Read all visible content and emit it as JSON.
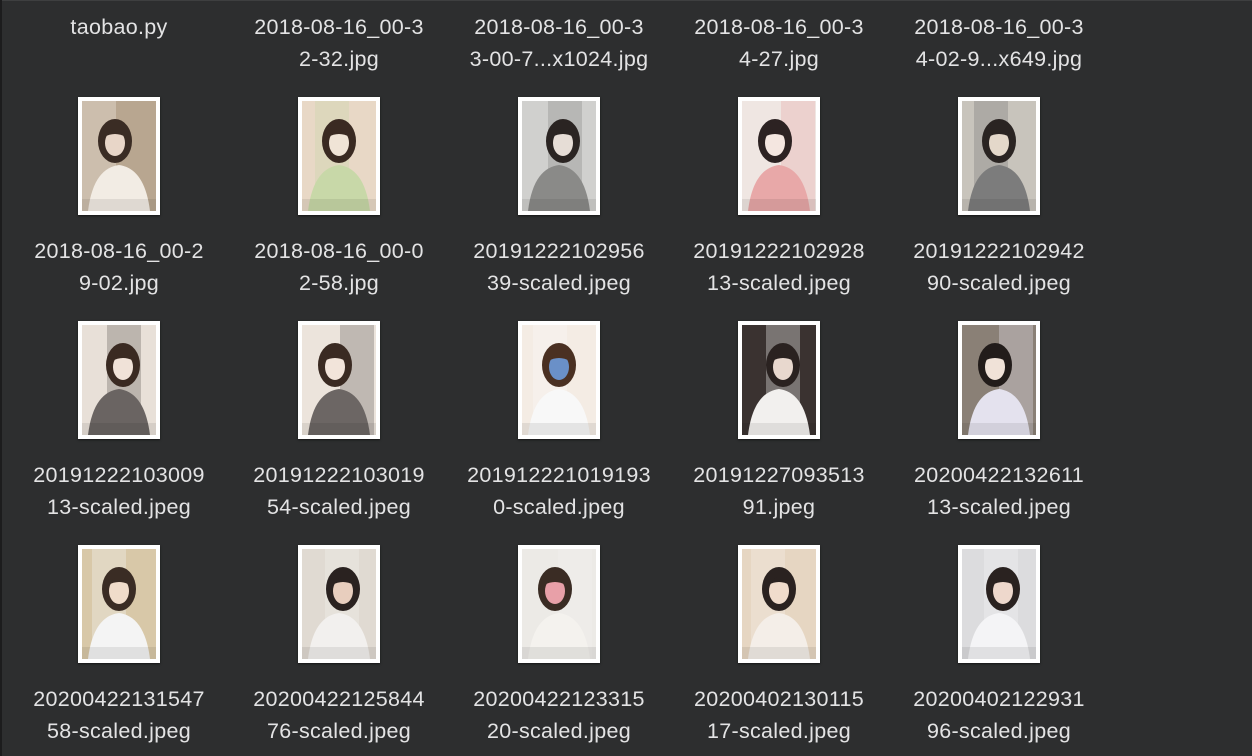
{
  "file_grid": {
    "rows": [
      {
        "items": [
          {
            "line1": "taobao.py",
            "line2": "",
            "has_thumb": false
          },
          {
            "line1": "2018-08-16_00-3",
            "line2": "2-32.jpg",
            "has_thumb": false
          },
          {
            "line1": "2018-08-16_00-3",
            "line2": "3-00-7...x1024.jpg",
            "has_thumb": false
          },
          {
            "line1": "2018-08-16_00-3",
            "line2": "4-27.jpg",
            "has_thumb": false
          },
          {
            "line1": "2018-08-16_00-3",
            "line2": "4-02-9...x649.jpg",
            "has_thumb": false
          }
        ]
      },
      {
        "items": [
          {
            "line1": "2018-08-16_00-2",
            "line2": "9-02.jpg",
            "has_thumb": true,
            "palette": [
              "#b8a690",
              "#f2ece4",
              "#3a2c24",
              "#e8d6c8"
            ]
          },
          {
            "line1": "2018-08-16_00-0",
            "line2": "2-58.jpg",
            "has_thumb": true,
            "palette": [
              "#e8d8c6",
              "#c8d8a8",
              "#3a2a22",
              "#f0e4d6"
            ]
          },
          {
            "line1": "20191222102956",
            "line2": "39-scaled.jpeg",
            "has_thumb": true,
            "palette": [
              "#d0d0ce",
              "#8a8a88",
              "#2a2422",
              "#e6ddd6"
            ]
          },
          {
            "line1": "20191222102928",
            "line2": "13-scaled.jpeg",
            "has_thumb": true,
            "palette": [
              "#efe6e2",
              "#e8a8a8",
              "#2c2222",
              "#f4e6e0"
            ]
          },
          {
            "line1": "20191222102942",
            "line2": "90-scaled.jpeg",
            "has_thumb": true,
            "palette": [
              "#c8c4bc",
              "#7c7c7c",
              "#2a2422",
              "#e4d8ca"
            ]
          }
        ]
      },
      {
        "items": [
          {
            "line1": "20191222103009",
            "line2": "13-scaled.jpeg",
            "has_thumb": true,
            "palette": [
              "#e8e0d8",
              "#6a6462",
              "#3a2a22",
              "#f0e2d8"
            ]
          },
          {
            "line1": "20191222103019",
            "line2": "54-scaled.jpeg",
            "has_thumb": true,
            "palette": [
              "#ece4dc",
              "#6c6664",
              "#3a2a22",
              "#f2e4da"
            ]
          },
          {
            "line1": "201912221019193",
            "line2": "0-scaled.jpeg",
            "has_thumb": true,
            "palette": [
              "#f4ece4",
              "#f8f8f8",
              "#4a3022",
              "#6a90c8"
            ]
          },
          {
            "line1": "20191227093513",
            "line2": "91.jpeg",
            "has_thumb": true,
            "palette": [
              "#3a3230",
              "#f2f0ee",
              "#2a2220",
              "#e8d8ce"
            ]
          },
          {
            "line1": "20200422132611",
            "line2": "13-scaled.jpeg",
            "has_thumb": true,
            "palette": [
              "#8a8076",
              "#e4e2ee",
              "#221c1a",
              "#f0e2d8"
            ]
          }
        ]
      },
      {
        "items": [
          {
            "line1": "20200422131547",
            "line2": "58-scaled.jpeg",
            "has_thumb": true,
            "palette": [
              "#d8c8a8",
              "#f4f4f4",
              "#3a2c24",
              "#f0dcca"
            ]
          },
          {
            "line1": "20200422125844",
            "line2": "76-scaled.jpeg",
            "has_thumb": true,
            "palette": [
              "#e0dad2",
              "#f2f0ee",
              "#2a2220",
              "#e8cebe"
            ]
          },
          {
            "line1": "20200422123315",
            "line2": "20-scaled.jpeg",
            "has_thumb": true,
            "palette": [
              "#eceae6",
              "#f4f2ee",
              "#3a2c24",
              "#e8a0a8"
            ]
          },
          {
            "line1": "20200402130115",
            "line2": "17-scaled.jpeg",
            "has_thumb": true,
            "palette": [
              "#e6d6c2",
              "#f4eee8",
              "#2a2220",
              "#f0dccc"
            ]
          },
          {
            "line1": "20200402122931",
            "line2": "96-scaled.jpeg",
            "has_thumb": true,
            "palette": [
              "#dcdcde",
              "#f4f4f6",
              "#2a2220",
              "#eed8cc"
            ]
          }
        ]
      }
    ]
  }
}
